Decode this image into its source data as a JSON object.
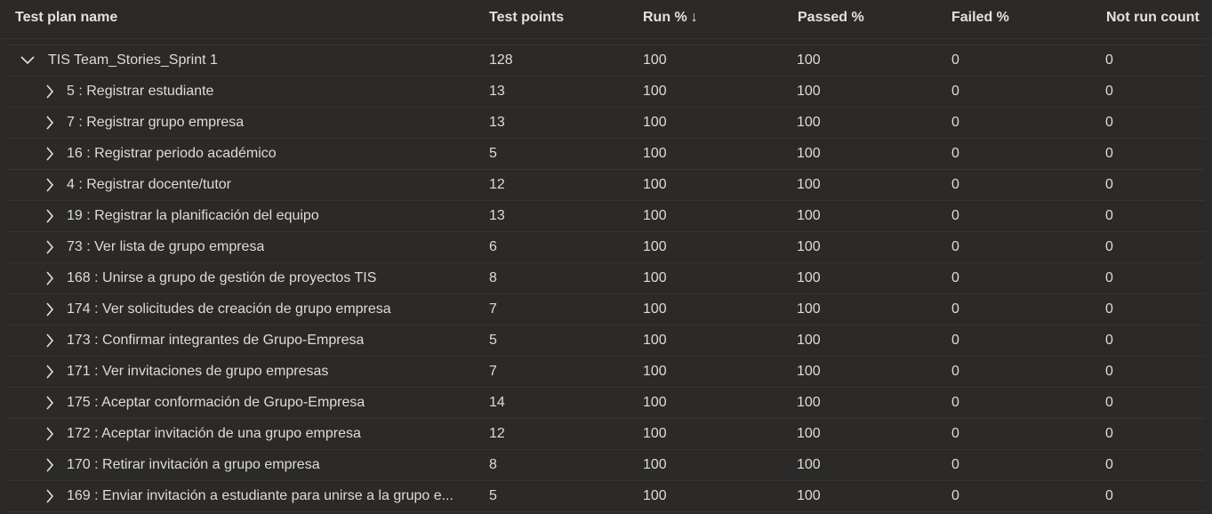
{
  "columns": {
    "name": "Test plan name",
    "points": "Test points",
    "run": "Run %",
    "run_sort_glyph": "↓",
    "passed": "Passed %",
    "failed": "Failed %",
    "notrun": "Not run count"
  },
  "parent": {
    "name": "TIS Team_Stories_Sprint 1",
    "points": "128",
    "run": "100",
    "passed": "100",
    "failed": "0",
    "notrun": "0",
    "expanded": true
  },
  "rows": [
    {
      "name": "5 : Registrar estudiante",
      "points": "13",
      "run": "100",
      "passed": "100",
      "failed": "0",
      "notrun": "0"
    },
    {
      "name": "7 : Registrar grupo empresa",
      "points": "13",
      "run": "100",
      "passed": "100",
      "failed": "0",
      "notrun": "0"
    },
    {
      "name": "16 : Registrar periodo académico",
      "points": "5",
      "run": "100",
      "passed": "100",
      "failed": "0",
      "notrun": "0"
    },
    {
      "name": "4 : Registrar docente/tutor",
      "points": "12",
      "run": "100",
      "passed": "100",
      "failed": "0",
      "notrun": "0"
    },
    {
      "name": "19 : Registrar la planificación del equipo",
      "points": "13",
      "run": "100",
      "passed": "100",
      "failed": "0",
      "notrun": "0"
    },
    {
      "name": "73 : Ver lista de grupo empresa",
      "points": "6",
      "run": "100",
      "passed": "100",
      "failed": "0",
      "notrun": "0"
    },
    {
      "name": "168 : Unirse a grupo de gestión de proyectos TIS",
      "points": "8",
      "run": "100",
      "passed": "100",
      "failed": "0",
      "notrun": "0"
    },
    {
      "name": "174 : Ver solicitudes de creación de grupo empresa",
      "points": "7",
      "run": "100",
      "passed": "100",
      "failed": "0",
      "notrun": "0"
    },
    {
      "name": "173 : Confirmar integrantes de Grupo-Empresa",
      "points": "5",
      "run": "100",
      "passed": "100",
      "failed": "0",
      "notrun": "0"
    },
    {
      "name": "171 : Ver invitaciones de grupo empresas",
      "points": "7",
      "run": "100",
      "passed": "100",
      "failed": "0",
      "notrun": "0"
    },
    {
      "name": "175 : Aceptar conformación de Grupo-Empresa",
      "points": "14",
      "run": "100",
      "passed": "100",
      "failed": "0",
      "notrun": "0"
    },
    {
      "name": "172 : Aceptar invitación de una grupo empresa",
      "points": "12",
      "run": "100",
      "passed": "100",
      "failed": "0",
      "notrun": "0"
    },
    {
      "name": "170 : Retirar invitación a grupo empresa",
      "points": "8",
      "run": "100",
      "passed": "100",
      "failed": "0",
      "notrun": "0"
    },
    {
      "name": "169 : Enviar invitación a estudiante para unirse a la grupo e...",
      "points": "5",
      "run": "100",
      "passed": "100",
      "failed": "0",
      "notrun": "0"
    }
  ],
  "colors": {
    "background": "#2b2a29",
    "text": "#dedcd8",
    "divider": "#363533"
  },
  "icons": {
    "expanded": "chevron-down-icon",
    "collapsed": "chevron-right-icon"
  }
}
